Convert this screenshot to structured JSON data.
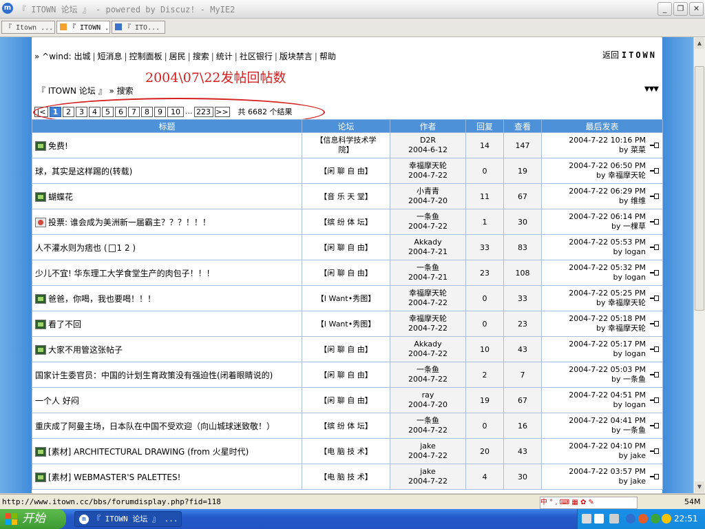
{
  "window": {
    "title": "『 ITOWN 论坛 』 - powered by Discuz! - MyIE2"
  },
  "tabs": [
    {
      "label": "『 Itown ..."
    },
    {
      "label": "『 ITOWN ..."
    },
    {
      "label": "『 ITO..."
    }
  ],
  "nav": {
    "prefix": "» ^wind:",
    "items": [
      "出城",
      "短消息",
      "控制面板",
      "居民",
      "搜索",
      "统计",
      "社区银行",
      "版块禁言",
      "帮助"
    ],
    "back_prefix": "返回",
    "back_brand": "ITOWN"
  },
  "annotation": "2004\\07\\22发帖回帖数",
  "breadcrumb": {
    "forum": "『 ITOWN 论坛 』",
    "sep": "»",
    "current": "搜索"
  },
  "pager": {
    "first": "|<",
    "pages": [
      "1",
      "2",
      "3",
      "4",
      "5",
      "6",
      "7",
      "8",
      "9",
      "10"
    ],
    "current": "1",
    "dots": "...",
    "last": "223",
    "next": ">>",
    "result_count": "共 6682 个结果"
  },
  "table": {
    "headers": {
      "title": "标题",
      "forum": "论坛",
      "author": "作者",
      "replies": "回复",
      "views": "查看",
      "last": "最后发表"
    },
    "rows": [
      {
        "icon": "image-thread-icon",
        "title": "免费!",
        "pages": "",
        "forum1": "【信息科学技术学",
        "forum2": "院】",
        "author": "D2R",
        "date": "2004-6-12",
        "replies": "14",
        "views": "147",
        "last_time": "2004-7-22 10:16 PM",
        "last_by": "by 菜菜"
      },
      {
        "icon": "",
        "title": "球，其实是这样踢的(转载)",
        "pages": "",
        "forum1": "【闲 聊 自 由】",
        "forum2": "",
        "author": "幸福摩天轮",
        "date": "2004-7-22",
        "replies": "0",
        "views": "19",
        "last_time": "2004-7-22 06:50 PM",
        "last_by": "by 幸福摩天轮"
      },
      {
        "icon": "image-thread-icon",
        "title": "蝴蝶花",
        "pages": "",
        "forum1": "【音 乐 天 堂】",
        "forum2": "",
        "author": "小青青",
        "date": "2004-7-20",
        "replies": "11",
        "views": "67",
        "last_time": "2004-7-22 06:29 PM",
        "last_by": "by 维维"
      },
      {
        "icon": "poll-icon",
        "title": "投票: 谁会成为美洲新一届霸主？？？！！！",
        "pages": "",
        "forum1": "【缤 纷 体 坛】",
        "forum2": "",
        "author": "一条鱼",
        "date": "2004-7-22",
        "replies": "1",
        "views": "30",
        "last_time": "2004-7-22 06:14 PM",
        "last_by": "by 一棵草"
      },
      {
        "icon": "",
        "title": "人不灌水则为痞也",
        "pages": "1 2 )",
        "forum1": "【闲 聊 自 由】",
        "forum2": "",
        "author": "Akkady",
        "date": "2004-7-21",
        "replies": "33",
        "views": "83",
        "last_time": "2004-7-22 05:53 PM",
        "last_by": "by logan"
      },
      {
        "icon": "",
        "title": "少儿不宜! 华东理工大学食堂生产的肉包子！！！",
        "pages": "",
        "forum1": "【闲 聊 自 由】",
        "forum2": "",
        "author": "一条鱼",
        "date": "2004-7-21",
        "replies": "23",
        "views": "108",
        "last_time": "2004-7-22 05:32 PM",
        "last_by": "by logan"
      },
      {
        "icon": "image-thread-icon",
        "title": "爸爸，你喝，我也要喝！！！",
        "pages": "",
        "forum1": "【I Want•秀图】",
        "forum2": "",
        "author": "幸福摩天轮",
        "date": "2004-7-22",
        "replies": "0",
        "views": "33",
        "last_time": "2004-7-22 05:25 PM",
        "last_by": "by 幸福摩天轮"
      },
      {
        "icon": "image-thread-icon",
        "title": "看了不回",
        "pages": "",
        "forum1": "【I Want•秀图】",
        "forum2": "",
        "author": "幸福摩天轮",
        "date": "2004-7-22",
        "replies": "0",
        "views": "23",
        "last_time": "2004-7-22 05:18 PM",
        "last_by": "by 幸福摩天轮"
      },
      {
        "icon": "image-thread-icon",
        "title": "大家不用管这张帖子",
        "pages": "",
        "forum1": "【闲 聊 自 由】",
        "forum2": "",
        "author": "Akkady",
        "date": "2004-7-22",
        "replies": "10",
        "views": "43",
        "last_time": "2004-7-22 05:17 PM",
        "last_by": "by logan"
      },
      {
        "icon": "",
        "title": "国家计生委官员：中国的计划生育政策没有强迫性(闭着眼睛说的)",
        "pages": "",
        "forum1": "【闲 聊 自 由】",
        "forum2": "",
        "author": "一条鱼",
        "date": "2004-7-22",
        "replies": "2",
        "views": "7",
        "last_time": "2004-7-22 05:03 PM",
        "last_by": "by 一条鱼"
      },
      {
        "icon": "",
        "title": "一个人 好闷",
        "pages": "",
        "forum1": "【闲 聊 自 由】",
        "forum2": "",
        "author": "ray",
        "date": "2004-7-20",
        "replies": "19",
        "views": "67",
        "last_time": "2004-7-22 04:51 PM",
        "last_by": "by logan"
      },
      {
        "icon": "",
        "title": "重庆成了阿曼主场，日本队在中国不受欢迎（向山城球迷致敬！）",
        "pages": "",
        "forum1": "【缤 纷 体 坛】",
        "forum2": "",
        "author": "一条鱼",
        "date": "2004-7-22",
        "replies": "0",
        "views": "16",
        "last_time": "2004-7-22 04:41 PM",
        "last_by": "by 一条鱼"
      },
      {
        "icon": "image-thread-icon",
        "title": "[素材] ARCHITECTURAL DRAWING (from 火星时代)",
        "pages": "",
        "forum1": "【电 脑 技 术】",
        "forum2": "",
        "author": "jake",
        "date": "2004-7-22",
        "replies": "20",
        "views": "43",
        "last_time": "2004-7-22 04:10 PM",
        "last_by": "by jake"
      },
      {
        "icon": "image-thread-icon",
        "title": "[素材] WEBMASTER'S PALETTES!",
        "pages": "",
        "forum1": "【电 脑 技 术】",
        "forum2": "",
        "author": "jake",
        "date": "2004-7-22",
        "replies": "4",
        "views": "30",
        "last_time": "2004-7-22 03:57 PM",
        "last_by": "by jake"
      }
    ]
  },
  "status": {
    "url": "http://www.itown.cc/bbs/forumdisplay.php?fid=118",
    "ime": "中 ° , ⌨ ▦ ✿ ✎",
    "memory": "54M"
  },
  "taskbar": {
    "start_label": "开始",
    "window_label": "『 ITOWN 论坛 』 ...",
    "clock": "22:51"
  },
  "colors": {
    "header_blue": "#4d91d8",
    "side_blue": "#3f8bdb",
    "annotation_red": "#d42020",
    "taskbar_blue": "#2459c9",
    "start_green": "#3a9a31"
  }
}
